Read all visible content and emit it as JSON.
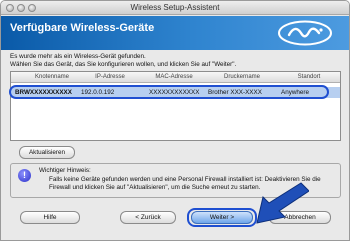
{
  "window": {
    "title": "Wireless Setup-Assistent"
  },
  "header": {
    "title": "Verfügbare Wireless-Geräte"
  },
  "instructions": {
    "line1": "Es wurde mehr als ein Wireless-Gerät gefunden.",
    "line2": "Wählen Sie das Gerät, das Sie konfigurieren wollen, und klicken Sie auf \"Weiter\"."
  },
  "table": {
    "columns": [
      "Knotenname",
      "IP-Adresse",
      "MAC-Adresse",
      "Druckername",
      "Standort"
    ],
    "rows": [
      {
        "name": "BRWXXXXXXXXXX",
        "ip": "192.0.0.192",
        "mac": "XXXXXXXXXXXX",
        "printer": "Brother XXX-XXXX",
        "location": "Anywhere"
      }
    ]
  },
  "buttons": {
    "refresh": "Aktualisieren",
    "help": "Hilfe",
    "back": "< Zurück",
    "next": "Weiter >",
    "cancel": "Abbrechen"
  },
  "note": {
    "title": "Wichtiger Hinweis:",
    "text": "Falls keine Geräte gefunden werden und eine Personal Firewall installiert ist: Deaktivieren Sie die Firewall und klicken Sie auf \"Aktualisieren\", um die Suche erneut zu starten."
  },
  "icons": {
    "warning": "info-icon",
    "arrow": "pointer-arrow-icon"
  },
  "colors": {
    "header_start": "#0a5aa8",
    "header_end": "#4d9be0",
    "selection": "#b7cff0",
    "highlight": "#1f4fd1"
  }
}
